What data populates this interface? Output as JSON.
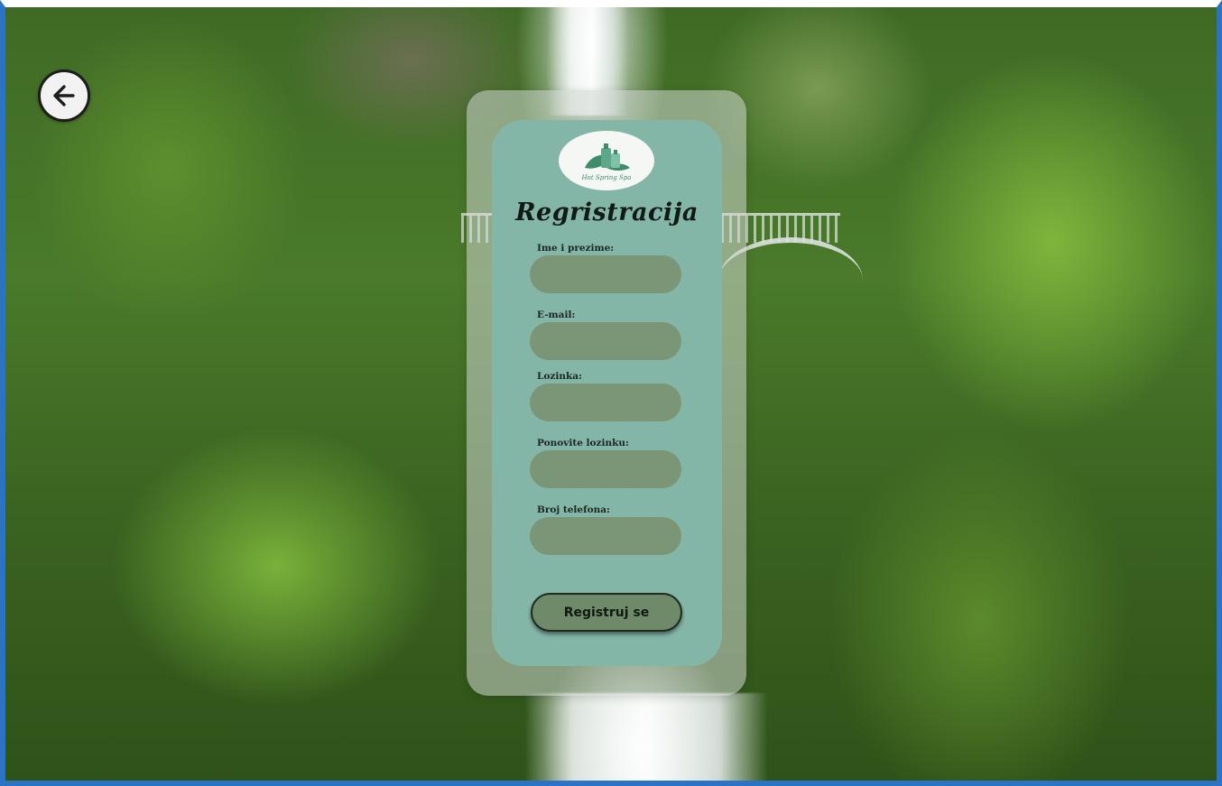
{
  "colors": {
    "card_background": "#84b6a7",
    "input_background": "#7b9676",
    "button_background": "#6f8a69",
    "text_dark": "#121a16",
    "window_border": "#2b73c4"
  },
  "back_button": {
    "icon": "arrow-left-icon"
  },
  "logo": {
    "icon": "spa-bottles-leaf-icon",
    "text": "Hot Spring Spa"
  },
  "form": {
    "title": "Regristracija",
    "fields": [
      {
        "label": "Ime i prezime:",
        "value": "",
        "placeholder": ""
      },
      {
        "label": "E-mail:",
        "value": "",
        "placeholder": ""
      },
      {
        "label": "Lozinka:",
        "value": "",
        "placeholder": ""
      },
      {
        "label": "Ponovite lozinku:",
        "value": "",
        "placeholder": ""
      },
      {
        "label": "Broj telefona:",
        "value": "",
        "placeholder": ""
      }
    ],
    "submit_label": "Registruj se"
  }
}
